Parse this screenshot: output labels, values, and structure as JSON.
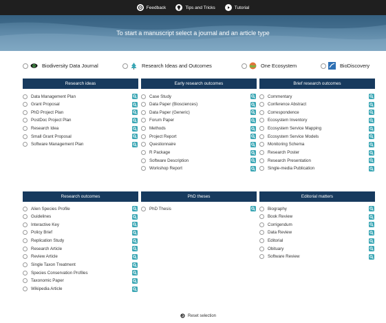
{
  "topbar": {
    "items": [
      {
        "label": "Feedback",
        "icon": "feedback-icon"
      },
      {
        "label": "Tips and Tricks",
        "icon": "lightbulb-icon"
      },
      {
        "label": "Tutorial",
        "icon": "play-icon"
      }
    ]
  },
  "banner": {
    "title": "To start a manuscript select a journal and an article type"
  },
  "journals": [
    {
      "label": "Biodiversity Data Journal",
      "icon": "eye-logo-icon"
    },
    {
      "label": "Research Ideas and Outcomes",
      "icon": "tree-logo-icon"
    },
    {
      "label": "One Ecosystem",
      "icon": "globe-logo-icon"
    },
    {
      "label": "BioDiscovery",
      "icon": "biodiscovery-logo-icon"
    }
  ],
  "sections": {
    "research_ideas": {
      "title": "Research ideas",
      "items": [
        "Data Management Plan",
        "Grant Proposal",
        "PhD Project Plan",
        "PostDoc Project Plan",
        "Research Idea",
        "Small Grant Proposal",
        "Software Management Plan"
      ]
    },
    "early_research_outcomes": {
      "title": "Early research outcomes",
      "items": [
        "Case Study",
        "Data Paper (Biosciences)",
        "Data Paper (Generic)",
        "Forum Paper",
        "Methods",
        "Project Report",
        "Questionnaire",
        "R Package",
        "Software Description",
        "Workshop Report"
      ]
    },
    "brief_research_outcomes": {
      "title": "Brief research outcomes",
      "items": [
        "Commentary",
        "Conference Abstract",
        "Correspondence",
        "Ecosystem Inventory",
        "Ecosystem Service Mapping",
        "Ecosystem Service Models",
        "Monitoring Schema",
        "Research Poster",
        "Research Presentation",
        "Single-media Publication"
      ]
    },
    "research_outcomes": {
      "title": "Research outcomes",
      "items": [
        "Alien Species Profile",
        "Guidelines",
        "Interactive Key",
        "Policy Brief",
        "Replication Study",
        "Research Article",
        "Review Article",
        "Single Taxon Treatment",
        "Species Conservation Profiles",
        "Taxonomic Paper",
        "Wikipedia Article"
      ]
    },
    "phd_theses": {
      "title": "PhD theses",
      "items": [
        "PhD Thesis"
      ]
    },
    "editorial_matters": {
      "title": "Editorial matters",
      "items": [
        "Biography",
        "Book Review",
        "Corrigendum",
        "Data Review",
        "Editorial",
        "Obituary",
        "Software Review"
      ]
    }
  },
  "reset": {
    "label": "Reset selection",
    "icon": "reset-icon"
  },
  "colors": {
    "header_bg": "#173a5e",
    "accent": "#3aa6b4",
    "topbar_bg": "#1f1f1f",
    "banner": "#5c87a6"
  }
}
